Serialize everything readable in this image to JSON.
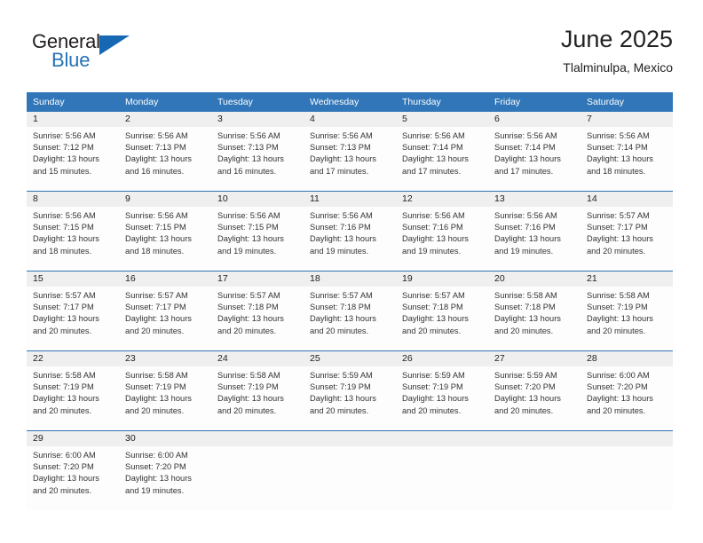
{
  "logo": {
    "word_top": "General",
    "word_bottom": "Blue",
    "triangle_color": "#1668b3",
    "blue_text_color": "#2573b5"
  },
  "header": {
    "title": "June 2025",
    "subtitle": "Tlalminulpa, Mexico"
  },
  "theme": {
    "header_blue": "#3076b8",
    "row_divider_blue": "#2f74b5",
    "daynum_strip": "#efefef",
    "cell_background": "#fdfdfd"
  },
  "calendar": {
    "weekday_headers": [
      "Sunday",
      "Monday",
      "Tuesday",
      "Wednesday",
      "Thursday",
      "Friday",
      "Saturday"
    ],
    "weeks": [
      [
        {
          "day": "1",
          "sunrise": "Sunrise: 5:56 AM",
          "sunset": "Sunset: 7:12 PM",
          "daylight_line1": "Daylight: 13 hours",
          "daylight_line2": "and 15 minutes."
        },
        {
          "day": "2",
          "sunrise": "Sunrise: 5:56 AM",
          "sunset": "Sunset: 7:13 PM",
          "daylight_line1": "Daylight: 13 hours",
          "daylight_line2": "and 16 minutes."
        },
        {
          "day": "3",
          "sunrise": "Sunrise: 5:56 AM",
          "sunset": "Sunset: 7:13 PM",
          "daylight_line1": "Daylight: 13 hours",
          "daylight_line2": "and 16 minutes."
        },
        {
          "day": "4",
          "sunrise": "Sunrise: 5:56 AM",
          "sunset": "Sunset: 7:13 PM",
          "daylight_line1": "Daylight: 13 hours",
          "daylight_line2": "and 17 minutes."
        },
        {
          "day": "5",
          "sunrise": "Sunrise: 5:56 AM",
          "sunset": "Sunset: 7:14 PM",
          "daylight_line1": "Daylight: 13 hours",
          "daylight_line2": "and 17 minutes."
        },
        {
          "day": "6",
          "sunrise": "Sunrise: 5:56 AM",
          "sunset": "Sunset: 7:14 PM",
          "daylight_line1": "Daylight: 13 hours",
          "daylight_line2": "and 17 minutes."
        },
        {
          "day": "7",
          "sunrise": "Sunrise: 5:56 AM",
          "sunset": "Sunset: 7:14 PM",
          "daylight_line1": "Daylight: 13 hours",
          "daylight_line2": "and 18 minutes."
        }
      ],
      [
        {
          "day": "8",
          "sunrise": "Sunrise: 5:56 AM",
          "sunset": "Sunset: 7:15 PM",
          "daylight_line1": "Daylight: 13 hours",
          "daylight_line2": "and 18 minutes."
        },
        {
          "day": "9",
          "sunrise": "Sunrise: 5:56 AM",
          "sunset": "Sunset: 7:15 PM",
          "daylight_line1": "Daylight: 13 hours",
          "daylight_line2": "and 18 minutes."
        },
        {
          "day": "10",
          "sunrise": "Sunrise: 5:56 AM",
          "sunset": "Sunset: 7:15 PM",
          "daylight_line1": "Daylight: 13 hours",
          "daylight_line2": "and 19 minutes."
        },
        {
          "day": "11",
          "sunrise": "Sunrise: 5:56 AM",
          "sunset": "Sunset: 7:16 PM",
          "daylight_line1": "Daylight: 13 hours",
          "daylight_line2": "and 19 minutes."
        },
        {
          "day": "12",
          "sunrise": "Sunrise: 5:56 AM",
          "sunset": "Sunset: 7:16 PM",
          "daylight_line1": "Daylight: 13 hours",
          "daylight_line2": "and 19 minutes."
        },
        {
          "day": "13",
          "sunrise": "Sunrise: 5:56 AM",
          "sunset": "Sunset: 7:16 PM",
          "daylight_line1": "Daylight: 13 hours",
          "daylight_line2": "and 19 minutes."
        },
        {
          "day": "14",
          "sunrise": "Sunrise: 5:57 AM",
          "sunset": "Sunset: 7:17 PM",
          "daylight_line1": "Daylight: 13 hours",
          "daylight_line2": "and 20 minutes."
        }
      ],
      [
        {
          "day": "15",
          "sunrise": "Sunrise: 5:57 AM",
          "sunset": "Sunset: 7:17 PM",
          "daylight_line1": "Daylight: 13 hours",
          "daylight_line2": "and 20 minutes."
        },
        {
          "day": "16",
          "sunrise": "Sunrise: 5:57 AM",
          "sunset": "Sunset: 7:17 PM",
          "daylight_line1": "Daylight: 13 hours",
          "daylight_line2": "and 20 minutes."
        },
        {
          "day": "17",
          "sunrise": "Sunrise: 5:57 AM",
          "sunset": "Sunset: 7:18 PM",
          "daylight_line1": "Daylight: 13 hours",
          "daylight_line2": "and 20 minutes."
        },
        {
          "day": "18",
          "sunrise": "Sunrise: 5:57 AM",
          "sunset": "Sunset: 7:18 PM",
          "daylight_line1": "Daylight: 13 hours",
          "daylight_line2": "and 20 minutes."
        },
        {
          "day": "19",
          "sunrise": "Sunrise: 5:57 AM",
          "sunset": "Sunset: 7:18 PM",
          "daylight_line1": "Daylight: 13 hours",
          "daylight_line2": "and 20 minutes."
        },
        {
          "day": "20",
          "sunrise": "Sunrise: 5:58 AM",
          "sunset": "Sunset: 7:18 PM",
          "daylight_line1": "Daylight: 13 hours",
          "daylight_line2": "and 20 minutes."
        },
        {
          "day": "21",
          "sunrise": "Sunrise: 5:58 AM",
          "sunset": "Sunset: 7:19 PM",
          "daylight_line1": "Daylight: 13 hours",
          "daylight_line2": "and 20 minutes."
        }
      ],
      [
        {
          "day": "22",
          "sunrise": "Sunrise: 5:58 AM",
          "sunset": "Sunset: 7:19 PM",
          "daylight_line1": "Daylight: 13 hours",
          "daylight_line2": "and 20 minutes."
        },
        {
          "day": "23",
          "sunrise": "Sunrise: 5:58 AM",
          "sunset": "Sunset: 7:19 PM",
          "daylight_line1": "Daylight: 13 hours",
          "daylight_line2": "and 20 minutes."
        },
        {
          "day": "24",
          "sunrise": "Sunrise: 5:58 AM",
          "sunset": "Sunset: 7:19 PM",
          "daylight_line1": "Daylight: 13 hours",
          "daylight_line2": "and 20 minutes."
        },
        {
          "day": "25",
          "sunrise": "Sunrise: 5:59 AM",
          "sunset": "Sunset: 7:19 PM",
          "daylight_line1": "Daylight: 13 hours",
          "daylight_line2": "and 20 minutes."
        },
        {
          "day": "26",
          "sunrise": "Sunrise: 5:59 AM",
          "sunset": "Sunset: 7:19 PM",
          "daylight_line1": "Daylight: 13 hours",
          "daylight_line2": "and 20 minutes."
        },
        {
          "day": "27",
          "sunrise": "Sunrise: 5:59 AM",
          "sunset": "Sunset: 7:20 PM",
          "daylight_line1": "Daylight: 13 hours",
          "daylight_line2": "and 20 minutes."
        },
        {
          "day": "28",
          "sunrise": "Sunrise: 6:00 AM",
          "sunset": "Sunset: 7:20 PM",
          "daylight_line1": "Daylight: 13 hours",
          "daylight_line2": "and 20 minutes."
        }
      ],
      [
        {
          "day": "29",
          "sunrise": "Sunrise: 6:00 AM",
          "sunset": "Sunset: 7:20 PM",
          "daylight_line1": "Daylight: 13 hours",
          "daylight_line2": "and 20 minutes."
        },
        {
          "day": "30",
          "sunrise": "Sunrise: 6:00 AM",
          "sunset": "Sunset: 7:20 PM",
          "daylight_line1": "Daylight: 13 hours",
          "daylight_line2": "and 19 minutes."
        },
        {
          "day": "",
          "sunrise": "",
          "sunset": "",
          "daylight_line1": "",
          "daylight_line2": ""
        },
        {
          "day": "",
          "sunrise": "",
          "sunset": "",
          "daylight_line1": "",
          "daylight_line2": ""
        },
        {
          "day": "",
          "sunrise": "",
          "sunset": "",
          "daylight_line1": "",
          "daylight_line2": ""
        },
        {
          "day": "",
          "sunrise": "",
          "sunset": "",
          "daylight_line1": "",
          "daylight_line2": ""
        },
        {
          "day": "",
          "sunrise": "",
          "sunset": "",
          "daylight_line1": "",
          "daylight_line2": ""
        }
      ]
    ]
  }
}
